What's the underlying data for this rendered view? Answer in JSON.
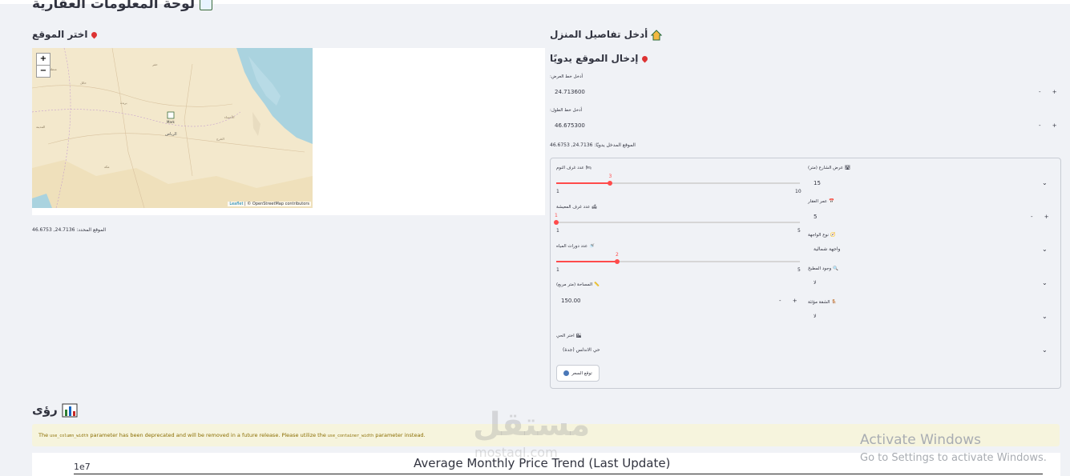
{
  "page": {
    "title": "لوحة المعلومات العقارية",
    "map_section_title": "اختر الموقع",
    "details_title": "أدخل تفاصيل المنزل",
    "manual_title": "إدخال الموقع يدويًا",
    "lat_label": "أدخل خط العرض:",
    "lat_value": "24.713600",
    "lon_label": "أدخل خط الطول:",
    "lon_value": "46.675300",
    "manual_result": "الموقع المدخل يدويًا: 24.7136, 46.6753",
    "selected_result": "الموقع المحدد: 24.7136, 46.6753",
    "stepper": "- +"
  },
  "map": {
    "zoom_in": "+",
    "zoom_out": "−",
    "marker_label": "Mark",
    "attribution_leaflet": "Leaflet",
    "attribution_rest": "| © OpenStreetMap contributors",
    "places": [
      "الأحساء",
      "الرياض",
      "المدينة المنورة",
      "الخرج",
      "مكة"
    ]
  },
  "form": {
    "bedrooms_label": "عدد غرف النوم",
    "bedrooms_value": "3",
    "bedrooms_min": "1",
    "bedrooms_max": "10",
    "bedrooms_fraction": 0.222,
    "living_label": "عدد غرف المعيشة",
    "living_value": "1",
    "living_min": "1",
    "living_max": "5",
    "living_fraction": 0,
    "bath_label": "عدد دورات المياه",
    "bath_value": "2",
    "bath_min": "1",
    "bath_max": "5",
    "bath_fraction": 0.25,
    "area_label": "المساحة (متر مربع)",
    "area_value": "150.00",
    "street_label": "عرض الشارع (متر)",
    "street_value": "15",
    "age_label": "عمر العقار",
    "age_value": "5",
    "facade_label": "نوع الواجهة",
    "facade_value": "واجهة شمالية",
    "kitchen_label": "وجود المطبخ",
    "kitchen_value": "لا",
    "furnished_label": "الشقة مؤثثة",
    "furnished_value": "لا",
    "district_label": "اختر الحي",
    "district_value": "حي الاندلس (جدة)",
    "predict_button": "توقع السعر"
  },
  "insights": {
    "title": "رؤى",
    "warning_pre": "The",
    "warning_code1": "use_column_width",
    "warning_mid": "parameter has been deprecated and will be removed in a future release. Please utilize the",
    "warning_code2": "use_container_width",
    "warning_post": "parameter instead.",
    "chart_title": "Average Monthly Price Trend (Last Update)",
    "chart_exponent": "1e7"
  },
  "overlays": {
    "activate_line1": "Activate Windows",
    "activate_line2": "Go to Settings to activate Windows.",
    "watermark": "مستقل",
    "watermark_latin": "mostaql.com"
  },
  "colors": {
    "accent": "#ff4b4b",
    "background": "#f0f2f6",
    "warning_bg": "#f6f4dd"
  }
}
